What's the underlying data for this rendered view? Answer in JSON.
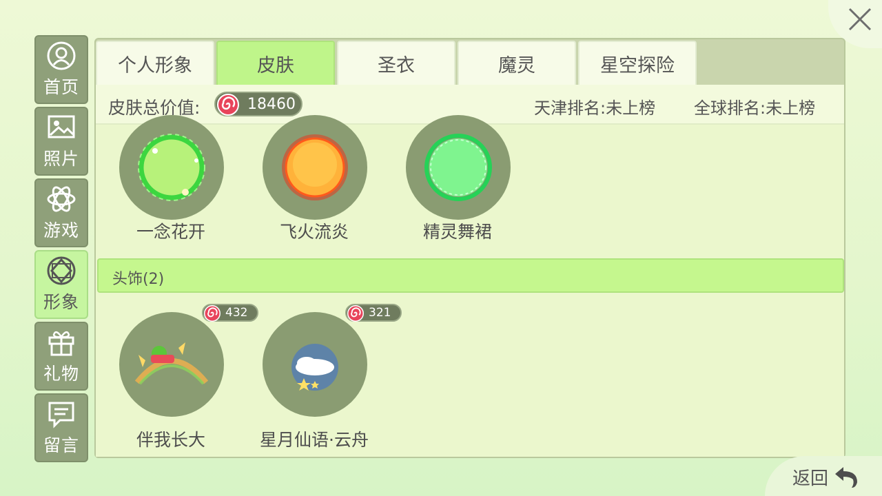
{
  "sidebar": {
    "items": [
      {
        "label": "首页",
        "icon": "user-icon"
      },
      {
        "label": "照片",
        "icon": "photo-icon"
      },
      {
        "label": "游戏",
        "icon": "atom-icon"
      },
      {
        "label": "形象",
        "icon": "gem-icon",
        "active": true
      },
      {
        "label": "礼物",
        "icon": "gift-icon"
      },
      {
        "label": "留言",
        "icon": "message-icon"
      }
    ]
  },
  "tabs": [
    {
      "label": "个人形象"
    },
    {
      "label": "皮肤",
      "active": true
    },
    {
      "label": "圣衣"
    },
    {
      "label": "魔灵"
    },
    {
      "label": "星空探险"
    }
  ],
  "summary": {
    "total_label": "皮肤总价值:",
    "total_value": "18460",
    "tianjin_rank": "天津排名:未上榜",
    "global_rank": "全球排名:未上榜"
  },
  "skins": [
    {
      "name": "一念花开",
      "color": "#7fea54"
    },
    {
      "name": "飞火流炎",
      "color": "#ff8a1f"
    },
    {
      "name": "精灵舞裙",
      "color": "#57f17e"
    }
  ],
  "headwear": {
    "section_label": "头饰(2)",
    "items": [
      {
        "name": "伴我长大",
        "price": "432"
      },
      {
        "name": "星月仙语·云舟",
        "price": "321"
      }
    ]
  },
  "back_label": "返回",
  "colors": {
    "accent": "#bff58a",
    "sidebar": "#8fa07a",
    "coin": "#e8445b"
  }
}
